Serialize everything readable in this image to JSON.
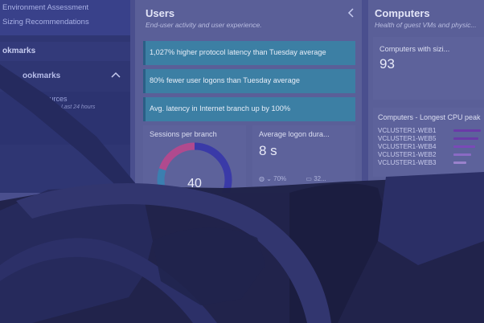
{
  "sidebar": {
    "link_assessment": "Environment Assessment",
    "link_sizing": "Sizing Recommendations",
    "heading": "okmarks",
    "sub_label": "ookmarks",
    "resources_label": "sources",
    "resources_time": "Last 24 hours"
  },
  "users": {
    "title": "Users",
    "subtitle": "End-user activity and user experience.",
    "insights": [
      {
        "text": "1,027% higher protocol latency than Tuesday average"
      },
      {
        "text": "80% fewer user logons than Tuesday average"
      },
      {
        "text": "Avg. latency in Internet branch up by 100%"
      }
    ],
    "sessions": {
      "title": "Sessions per branch",
      "value": "40",
      "segments": [
        {
          "share": 0.42,
          "color": "#3a3aa8"
        },
        {
          "share": 0.38,
          "color": "#3b7fb0"
        },
        {
          "share": 0.2,
          "color": "#b04a8e"
        }
      ]
    },
    "logon": {
      "title": "Average logon dura...",
      "value": "8 s",
      "trend": "70%",
      "trend_extra": "32..."
    }
  },
  "computers": {
    "title": "Computers",
    "subtitle": "Health of guest VMs and physic...",
    "sizing_title": "Computers with sizi...",
    "sizing_value": "93",
    "cpu_title": "Computers - Longest CPU peak",
    "vms": [
      {
        "name": "VCLUSTER1-WEB1",
        "fraction": 0.95,
        "color": "#6a3aa8"
      },
      {
        "name": "VCLUSTER1-WEB5",
        "fraction": 0.85,
        "color": "#6a3aa8"
      },
      {
        "name": "VCLUSTER1-WEB4",
        "fraction": 0.75,
        "color": "#7a4ab8"
      },
      {
        "name": "VCLUSTER1-WEB2",
        "fraction": 0.6,
        "color": "#8a6ac4"
      },
      {
        "name": "VCLUSTER1-WEB3",
        "fraction": 0.45,
        "color": "#9a82cc"
      }
    ]
  }
}
